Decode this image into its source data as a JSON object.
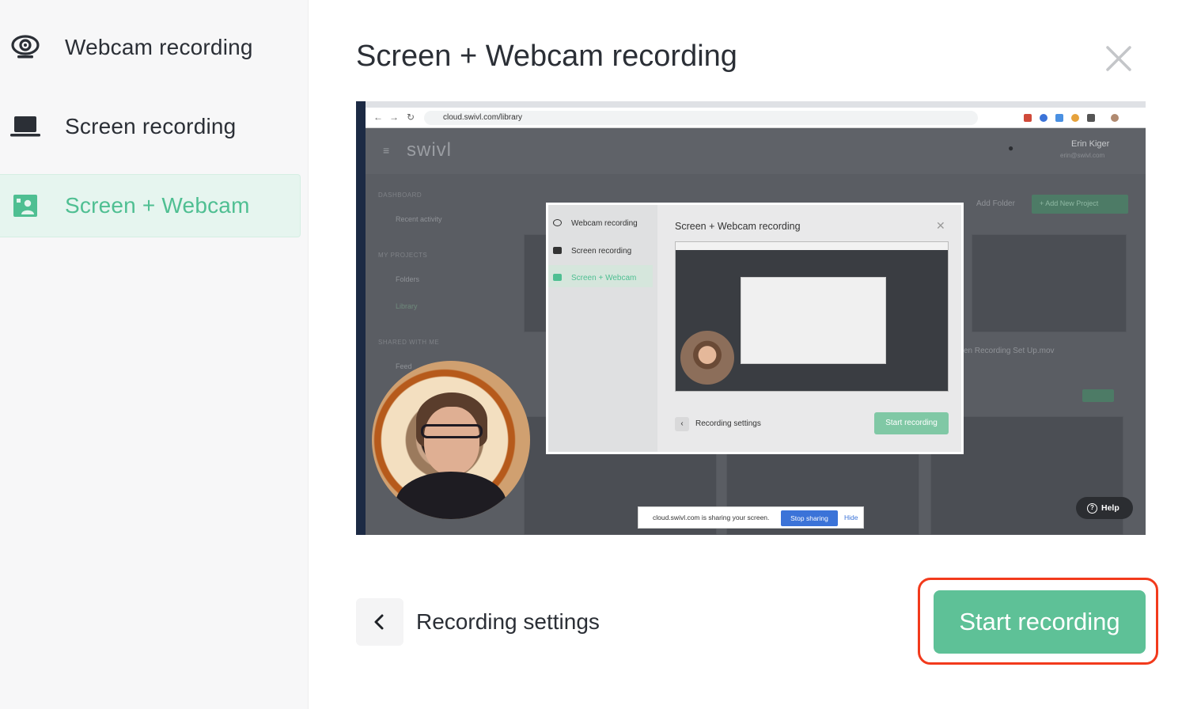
{
  "sidebar": {
    "items": [
      {
        "label": "Webcam recording",
        "icon": "webcam-icon"
      },
      {
        "label": "Screen recording",
        "icon": "laptop-icon"
      },
      {
        "label": "Screen + Webcam",
        "icon": "screen-webcam-icon",
        "active": true
      }
    ]
  },
  "dialog": {
    "title": "Screen + Webcam recording",
    "close_icon": "close-icon"
  },
  "preview": {
    "url": "cloud.swivl.com/library",
    "app": {
      "brand": "swivl",
      "user_name": "Erin Kiger",
      "user_email": "erin@swivl.com",
      "section_dashboard": "DASHBOARD",
      "recent_activity": "Recent activity",
      "section_projects": "MY PROJECTS",
      "folders": "Folders",
      "library": "Library",
      "section_shared": "SHARED WITH ME",
      "feed": "Feed",
      "add_folder": "Add Folder",
      "add_project": "+ Add New Project",
      "file_name": "en Recording Set Up.mov"
    },
    "nested_dialog": {
      "items": [
        "Webcam recording",
        "Screen recording",
        "Screen + Webcam"
      ],
      "title": "Screen + Webcam recording",
      "settings_label": "Recording settings",
      "start_label": "Start recording"
    },
    "share_bar": {
      "text": "cloud.swivl.com is sharing your screen.",
      "stop_label": "Stop sharing",
      "hide_label": "Hide"
    },
    "help_label": "Help"
  },
  "footer": {
    "settings_label": "Recording settings",
    "start_label": "Start recording"
  },
  "colors": {
    "accent": "#5ec197",
    "active_bg": "#e6f5ef",
    "highlight": "#f23a1c"
  }
}
